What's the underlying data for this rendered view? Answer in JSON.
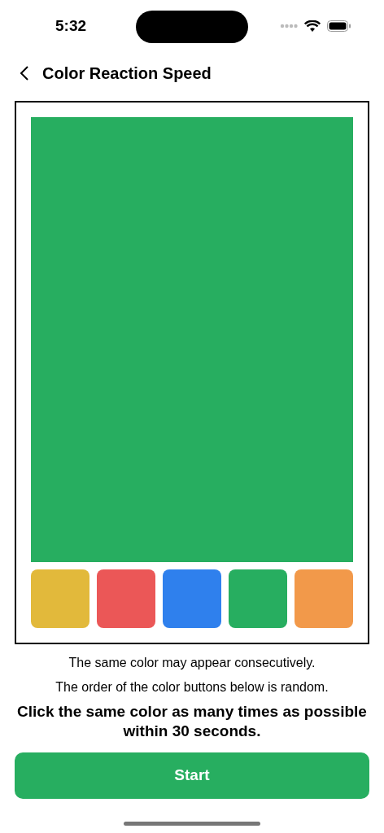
{
  "status_bar": {
    "time": "5:32"
  },
  "header": {
    "title": "Color Reaction Speed"
  },
  "display": {
    "color": "#27ae60"
  },
  "color_buttons": [
    {
      "color": "#e2b93b"
    },
    {
      "color": "#eb5757"
    },
    {
      "color": "#2f80ed"
    },
    {
      "color": "#27ae60"
    },
    {
      "color": "#f2994a"
    }
  ],
  "notes": [
    "The same color may appear consecutively.",
    "The order of the color buttons below is random."
  ],
  "instruction": "Click the same color as many times as possible within 30 seconds.",
  "start_button": {
    "label": "Start"
  }
}
